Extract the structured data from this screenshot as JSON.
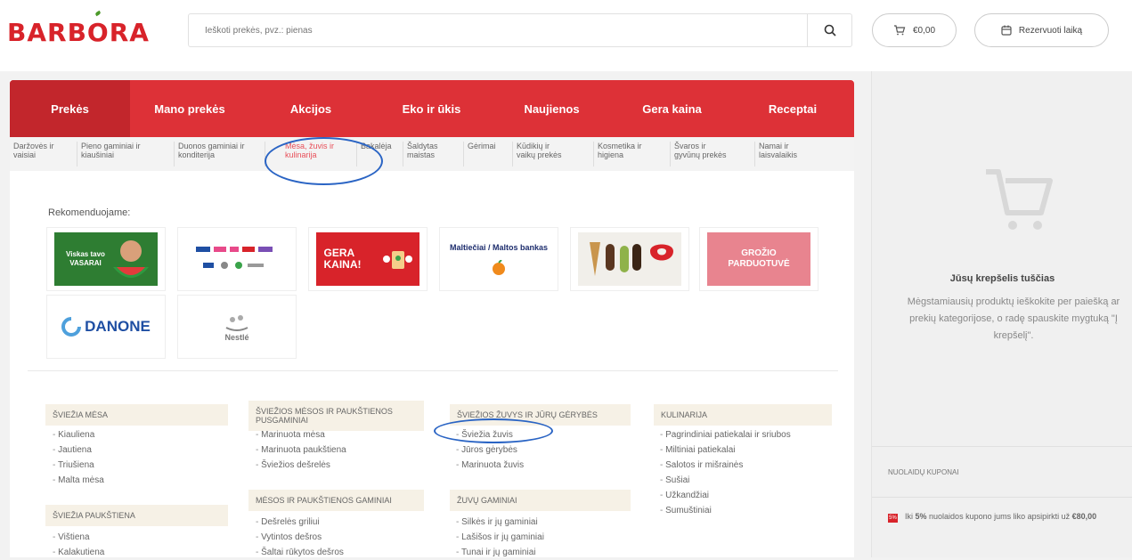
{
  "header": {
    "logo": "BARBORA",
    "search_placeholder": "Ieškoti prekės, pvz.: pienas",
    "cart_total": "€0,00",
    "reserve_label": "Rezervuoti laiką"
  },
  "nav": {
    "tabs": [
      {
        "label": "Prekės",
        "active": true
      },
      {
        "label": "Mano prekės"
      },
      {
        "label": "Akcijos"
      },
      {
        "label": "Eko ir ūkis"
      },
      {
        "label": "Naujienos"
      },
      {
        "label": "Gera kaina"
      },
      {
        "label": "Receptai"
      }
    ]
  },
  "subnav": {
    "items": [
      {
        "line1": "Daržovės ir",
        "line2": "vaisiai"
      },
      {
        "line1": "Pieno gaminiai ir",
        "line2": "kiaušiniai"
      },
      {
        "line1": "Duonos gaminiai ir",
        "line2": "konditerija"
      },
      {
        "line1": "Mėsa, žuvis ir",
        "line2": "kulinarija",
        "active": true
      },
      {
        "line1": "Bakalėja",
        "line2": ""
      },
      {
        "line1": "Šaldytas",
        "line2": "maistas"
      },
      {
        "line1": "Gėrimai",
        "line2": ""
      },
      {
        "line1": "Kūdikių ir",
        "line2": "vaikų prekės"
      },
      {
        "line1": "Kosmetika ir",
        "line2": "higiena"
      },
      {
        "line1": "Švaros ir",
        "line2": "gyvūnų prekės"
      },
      {
        "line1": "Namai ir",
        "line2": "laisvalaikis"
      }
    ]
  },
  "recommend": {
    "label": "Rekomenduojame:",
    "brands": [
      {
        "name": "Viskas tavo VASARAI",
        "color": "#2e7d32"
      },
      {
        "name": "Mixed brand logos",
        "color": "#ffffff"
      },
      {
        "name": "GERA KAINA!",
        "color": "#d8232a"
      },
      {
        "name": "Maltiečiai / Maltos bankas",
        "color": "#ffffff"
      },
      {
        "name": "Ice cream",
        "color": "#eeeeee"
      },
      {
        "name": "GROŽIO PARDUOTUVĖ",
        "color": "#e8848f"
      },
      {
        "name": "DANONE",
        "color": "#ffffff"
      },
      {
        "name": "Nestlé",
        "color": "#ffffff"
      }
    ]
  },
  "categories": [
    {
      "title": "Šviežia mėsa",
      "items": [
        "Kiauliena",
        "Jautiena",
        "Triušiena",
        "Malta mėsa"
      ]
    },
    {
      "title": "Šviežia paukštiena",
      "items": [
        "Vištiena",
        "Kalakutiena"
      ]
    },
    {
      "title": "Šviežios mėsos ir paukštienos pusgaminiai",
      "items": [
        "Marinuota mėsa",
        "Marinuota paukštiena",
        "Šviežios dešrelės"
      ]
    },
    {
      "title": "Mėsos ir paukštienos gaminiai",
      "items": [
        "Dešrelės griliui",
        "Vytintos dešros",
        "Šaltai rūkytos dešros"
      ]
    },
    {
      "title": "Šviežios žuvys ir jūrų gėrybės",
      "items": [
        "Šviežia žuvis",
        "Jūros gėrybės",
        "Marinuota žuvis"
      ]
    },
    {
      "title": "Žuvų gaminiai",
      "items": [
        "Silkės ir jų gaminiai",
        "Lašišos ir jų gaminiai",
        "Tunai ir jų gaminiai"
      ]
    },
    {
      "title": "Kulinarija",
      "items": [
        "Pagrindiniai patiekalai ir sriubos",
        "Miltiniai patiekalai",
        "Salotos ir mišrainės",
        "Sušiai",
        "Užkandžiai",
        "Sumuštiniai"
      ]
    }
  ],
  "cart": {
    "empty_title": "Jūsų krepšelis tuščias",
    "empty_text": "Mėgstamiausių produktų ieškokite per paiešką ar prekių kategorijose, o radę spauskite mygtuką \"Į krepšelį\".",
    "coupon_label": "Nuolaidų kuponai",
    "coupon_badge": "5%",
    "coupon_text_a": "Iki ",
    "coupon_pct": "5%",
    "coupon_text_b": " nuolaidos kupono jums liko apsipirkti už ",
    "coupon_amount": "€80,00"
  },
  "colors": {
    "brand_red": "#d8232a",
    "nav_red": "#dd3137",
    "annotation_blue": "#2a64c4"
  }
}
